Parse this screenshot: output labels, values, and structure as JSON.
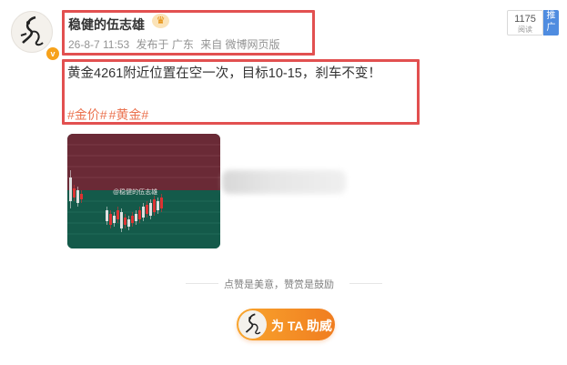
{
  "post": {
    "username": "稳健的伍志雄",
    "meta": {
      "date": "26-8-7 11:53",
      "published_in": "发布于 广东",
      "source": "来自 微博网页版"
    },
    "text": "黄金4261附近位置在空一次，目标10-15，刹车不变！",
    "tags": [
      "#金价#",
      "#黄金#"
    ]
  },
  "counter": {
    "value": "1175",
    "label": "阅读"
  },
  "promote": {
    "label": "推广"
  },
  "image": {
    "watermark": "@稳健的伍志雄"
  },
  "reward": {
    "divider_text": "点赞是美意，赞赏是鼓励",
    "button_label": "为 TA 助威"
  },
  "colors": {
    "tag": "#eb7350",
    "reward_start": "#f9a52d",
    "reward_end": "#f07d20",
    "highlight_box": "#e25050"
  }
}
